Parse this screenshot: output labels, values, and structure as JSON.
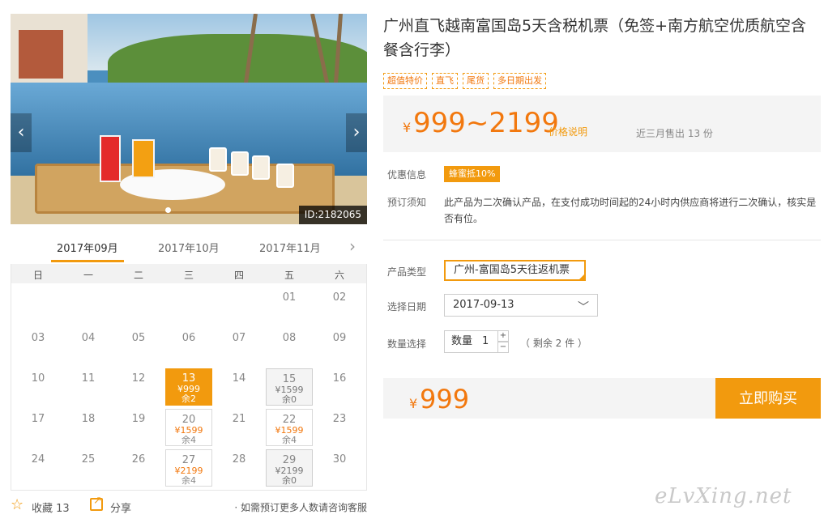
{
  "hero": {
    "id_label": "ID:2182065",
    "prev_icon": "chevron-left-icon",
    "next_icon": "chevron-right-icon"
  },
  "calendar": {
    "months": [
      "2017年09月",
      "2017年10月",
      "2017年11月"
    ],
    "active_month": 0,
    "weekdays": [
      "日",
      "一",
      "二",
      "三",
      "四",
      "五",
      "六"
    ],
    "days": [
      {
        "d": "01"
      },
      {
        "d": "02"
      },
      {
        "d": "03"
      },
      {
        "d": "04"
      },
      {
        "d": "05"
      },
      {
        "d": "06"
      },
      {
        "d": "07"
      },
      {
        "d": "08"
      },
      {
        "d": "09"
      },
      {
        "d": "10"
      },
      {
        "d": "11"
      },
      {
        "d": "12"
      },
      {
        "d": "13",
        "price": "¥999",
        "remain": "余2",
        "state": "selected"
      },
      {
        "d": "14"
      },
      {
        "d": "15",
        "price": "¥1599",
        "remain": "余0",
        "state": "soldout"
      },
      {
        "d": "16"
      },
      {
        "d": "17"
      },
      {
        "d": "18"
      },
      {
        "d": "19"
      },
      {
        "d": "20",
        "price": "¥1599",
        "remain": "余4",
        "state": "available"
      },
      {
        "d": "21"
      },
      {
        "d": "22",
        "price": "¥1599",
        "remain": "余4",
        "state": "available"
      },
      {
        "d": "23"
      },
      {
        "d": "24"
      },
      {
        "d": "25"
      },
      {
        "d": "26"
      },
      {
        "d": "27",
        "price": "¥2199",
        "remain": "余4",
        "state": "available"
      },
      {
        "d": "28"
      },
      {
        "d": "29",
        "price": "¥2199",
        "remain": "余0",
        "state": "soldout"
      },
      {
        "d": "30"
      }
    ]
  },
  "actions": {
    "favorite_label": "收藏 13",
    "share_label": "分享",
    "group_note": "· 如需预订更多人数请咨询客服"
  },
  "product": {
    "title": "广州直飞越南富国岛5天含税机票（免签+南方航空优质航空含餐含行李）",
    "tags": [
      "超值特价",
      "直飞",
      "尾货",
      "多日期出发"
    ],
    "price_currency": "¥",
    "price_range": "999~2199",
    "price_explain": "价格说明",
    "sold_text": "近三月售出 13 份",
    "promo_label": "优惠信息",
    "promo_badge": "蜂蜜抵10%",
    "notice_label": "预订须知",
    "notice_text": "此产品为二次确认产品，在支付成功时间起的24小时内供应商将进行二次确认，核实是否有位。",
    "type_label": "产品类型",
    "type_value": "广州-富国岛5天往返机票",
    "date_label": "选择日期",
    "date_value": "2017-09-13",
    "qty_label": "数量选择",
    "qty_prefix": "数量",
    "qty_value": "1",
    "qty_remain": "（ 剩余 2 件 ）",
    "total_currency": "¥",
    "total": "999",
    "buy_label": "立即购买"
  },
  "watermark": "eLvXing.net",
  "colors": {
    "accent": "#f29a0e",
    "price": "#f2780e"
  }
}
